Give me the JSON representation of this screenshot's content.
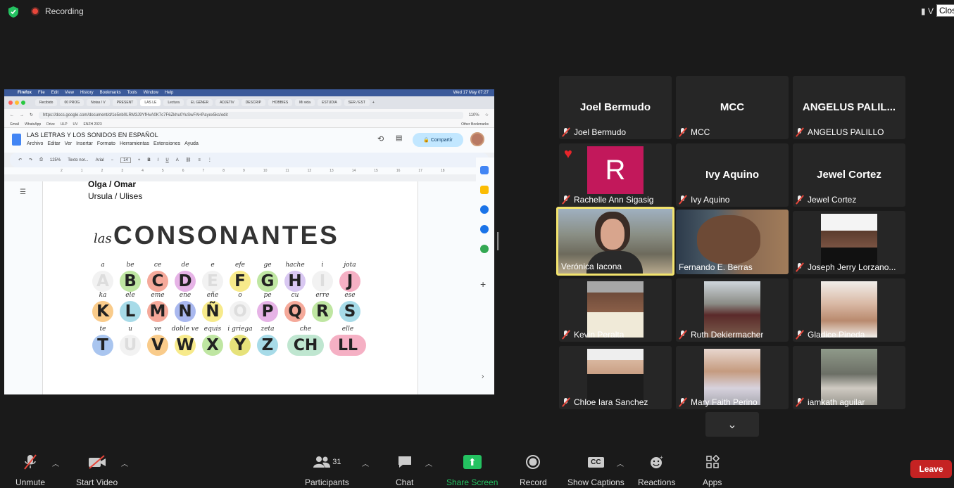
{
  "topbar": {
    "recording_label": "Recording",
    "view_label": "V",
    "close_tooltip": "Clos"
  },
  "shared_screen": {
    "mac_menu": [
      "Firefox",
      "File",
      "Edit",
      "View",
      "History",
      "Bookmarks",
      "Tools",
      "Window",
      "Help"
    ],
    "clock": "Wed 17 May  07:27",
    "tabs": [
      "Recibido",
      "00 PROG",
      "Notas / V",
      "PRESENT",
      "LAS LE",
      "Lectura",
      "EL GÉNER",
      "ADJETIV",
      "DESCRIP",
      "HOBBIES",
      "Mi vida",
      "ESTUDIA",
      "SER / EST"
    ],
    "url": "https://docs.google.com/document/d/1e5nb0LRM3J9YfHvA0K7c7F6Zkhu0YuSwFAHPayex5ks/edit",
    "zoom_browser": "110%",
    "bookmarks": [
      "Gmail",
      "WhatsApp",
      "Drive",
      "ULP",
      "UV",
      "ENZH 2023"
    ],
    "other_bookmarks": "Other Bookmarks",
    "doc_title": "LAS LETRAS Y LOS SONIDOS EN ESPAÑOL",
    "doc_menu": [
      "Archivo",
      "Editar",
      "Ver",
      "Insertar",
      "Formato",
      "Herramientas",
      "Extensiones",
      "Ayuda"
    ],
    "share_button": "Compartir",
    "toolbar": {
      "zoom": "125%",
      "style": "Texto nor...",
      "font": "Arial",
      "size": "14"
    },
    "ruler_numbers": [
      "2",
      "1",
      "1",
      "2",
      "3",
      "4",
      "5",
      "6",
      "7",
      "8",
      "9",
      "10",
      "11",
      "12",
      "13",
      "14",
      "15",
      "16",
      "17",
      "18"
    ],
    "doc_lines": [
      "Olga / Omar",
      "Ursula / Ulises"
    ],
    "consonants_prefix": "las",
    "consonants_title": "CONSONANTES",
    "letters": [
      {
        "letter": "A",
        "name": "a",
        "color": "#f2f2f2",
        "fg": "#ddd"
      },
      {
        "letter": "B",
        "name": "be",
        "color": "#bfe6a2",
        "fg": "#222"
      },
      {
        "letter": "C",
        "name": "ce",
        "color": "#f5a99a",
        "fg": "#222"
      },
      {
        "letter": "D",
        "name": "de",
        "color": "#e6b3e6",
        "fg": "#222"
      },
      {
        "letter": "E",
        "name": "e",
        "color": "#f2f2f2",
        "fg": "#ddd"
      },
      {
        "letter": "F",
        "name": "efe",
        "color": "#f7ea8b",
        "fg": "#222"
      },
      {
        "letter": "G",
        "name": "ge",
        "color": "#bfe6a2",
        "fg": "#222"
      },
      {
        "letter": "H",
        "name": "hache",
        "color": "#d9c8f2",
        "fg": "#222"
      },
      {
        "letter": "I",
        "name": "i",
        "color": "#f2f2f2",
        "fg": "#ddd"
      },
      {
        "letter": "J",
        "name": "jota",
        "color": "#f5b0c4",
        "fg": "#222"
      },
      {
        "letter": "K",
        "name": "ka",
        "color": "#f9cb8a",
        "fg": "#222"
      },
      {
        "letter": "L",
        "name": "ele",
        "color": "#a7dbe8",
        "fg": "#222"
      },
      {
        "letter": "M",
        "name": "eme",
        "color": "#f5a99a",
        "fg": "#222"
      },
      {
        "letter": "N",
        "name": "ene",
        "color": "#a9b8ef",
        "fg": "#222"
      },
      {
        "letter": "Ñ",
        "name": "eñe",
        "color": "#f7ea8b",
        "fg": "#222"
      },
      {
        "letter": "O",
        "name": "o",
        "color": "#f2f2f2",
        "fg": "#ddd"
      },
      {
        "letter": "P",
        "name": "pe",
        "color": "#e6b3e6",
        "fg": "#222"
      },
      {
        "letter": "Q",
        "name": "cu",
        "color": "#f5a99a",
        "fg": "#222"
      },
      {
        "letter": "R",
        "name": "erre",
        "color": "#bfe6a2",
        "fg": "#222"
      },
      {
        "letter": "S",
        "name": "ese",
        "color": "#a7dbe8",
        "fg": "#222"
      },
      {
        "letter": "T",
        "name": "te",
        "color": "#a9c5ef",
        "fg": "#222"
      },
      {
        "letter": "U",
        "name": "u",
        "color": "#f2f2f2",
        "fg": "#ddd"
      },
      {
        "letter": "V",
        "name": "ve",
        "color": "#f9cb8a",
        "fg": "#222"
      },
      {
        "letter": "W",
        "name": "doble ve",
        "color": "#f7ea8b",
        "fg": "#222"
      },
      {
        "letter": "X",
        "name": "equis",
        "color": "#bfe6a2",
        "fg": "#222"
      },
      {
        "letter": "Y",
        "name": "i griega",
        "color": "#e6e27a",
        "fg": "#222"
      },
      {
        "letter": "Z",
        "name": "zeta",
        "color": "#a7dbe8",
        "fg": "#222"
      },
      {
        "letter": "CH",
        "name": "che",
        "color": "#bfe6d0",
        "fg": "#222"
      },
      {
        "letter": "LL",
        "name": "elle",
        "color": "#f5b0c4",
        "fg": "#222"
      }
    ]
  },
  "participants_tiles": [
    {
      "name": "Joel Bermudo",
      "display": "Joel Bermudo",
      "video": false
    },
    {
      "name": "MCC",
      "display": "MCC",
      "video": false
    },
    {
      "name": "ANGELUS PALILLO",
      "display": "ANGELUS PALIL...",
      "video": false
    },
    {
      "name": "Rachelle Ann Sigasig",
      "display": "R",
      "video": false
    },
    {
      "name": "Ivy Aquino",
      "display": "Ivy Aquino",
      "video": false
    },
    {
      "name": "Jewel Cortez",
      "display": "Jewel Cortez",
      "video": false
    },
    {
      "name": "Verónica Iacona",
      "display": "",
      "video": true
    },
    {
      "name": "Fernando E. Berras",
      "display": "",
      "video": true
    },
    {
      "name": "Joseph Jerry Lorzano...",
      "display": "",
      "video": true
    },
    {
      "name": "Kevin Peralta",
      "display": "",
      "video": true
    },
    {
      "name": "Ruth Dekiermacher",
      "display": "",
      "video": true
    },
    {
      "name": "Gladice Pineda",
      "display": "",
      "video": true
    },
    {
      "name": "Chloe Iara Sanchez",
      "display": "",
      "video": true
    },
    {
      "name": "Mary Faith Perino",
      "display": "",
      "video": true
    },
    {
      "name": "iamkath aguilar",
      "display": "",
      "video": true
    }
  ],
  "controls": {
    "unmute": "Unmute",
    "start_video": "Start Video",
    "participants": "Participants",
    "participants_count": "31",
    "chat": "Chat",
    "share_screen": "Share Screen",
    "record": "Record",
    "show_captions": "Show Captions",
    "captions_badge": "CC",
    "reactions": "Reactions",
    "apps": "Apps",
    "leave": "Leave"
  },
  "colors": {
    "share_green": "#24c261",
    "leave_red": "#c52323",
    "active_speaker": "#f2e36d"
  }
}
